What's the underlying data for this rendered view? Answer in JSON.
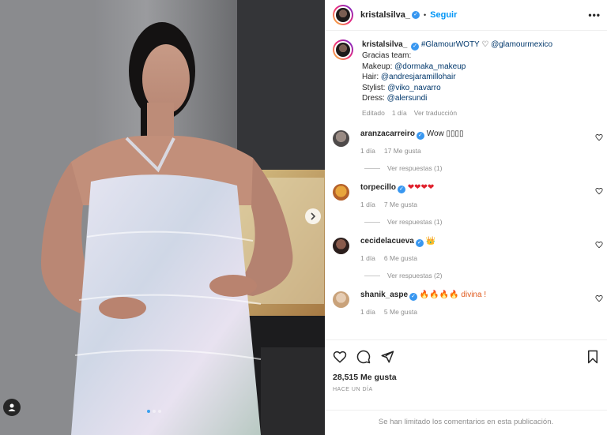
{
  "post": {
    "author": "kristalsilva_",
    "follow_label": "Seguir",
    "separator": "•",
    "more_label": "•••",
    "caption": {
      "author": "kristalsilva_",
      "hashtag": "#GlamourWOTY",
      "heart": "♡",
      "mention": "@glamourmexico",
      "lines": [
        {
          "label": "Gracias team:",
          "link": ""
        },
        {
          "label": "Makeup: ",
          "link": "@dormaka_makeup"
        },
        {
          "label": "Hair: ",
          "link": "@andresjaramillohair"
        },
        {
          "label": "Stylist: ",
          "link": "@viko_navarro"
        },
        {
          "label": "Dress: ",
          "link": "@alersundi"
        }
      ],
      "edited": "Editado",
      "time": "1 día",
      "translate": "Ver traducción"
    }
  },
  "comments": [
    {
      "user": "aranzacarreiro",
      "text": "Wow 𝅘𝅥𝅘𝅥𝅘𝅥𝅘𝅥",
      "display_text": "Wow ▯▯▯▯",
      "time": "1 día",
      "likes": "17 Me gusta",
      "replies": "Ver respuestas (1)"
    },
    {
      "user": "torpecillo",
      "text": "❤❤❤❤",
      "time": "1 día",
      "likes": "7 Me gusta",
      "replies": "Ver respuestas (1)"
    },
    {
      "user": "cecidelacueva",
      "text": "👑",
      "time": "1 día",
      "likes": "6 Me gusta",
      "replies": "Ver respuestas (2)"
    },
    {
      "user": "shanik_aspe",
      "text": "🔥🔥🔥🔥 divina !",
      "time": "1 día",
      "likes": "5 Me gusta",
      "replies": ""
    }
  ],
  "stats": {
    "likes": "28,515 Me gusta",
    "posted_ago": "HACE UN DÍA"
  },
  "footer": {
    "notice": "Se han limitado los comentarios en esta publicación."
  },
  "carousel": {
    "total_slides": 3,
    "current_slide": 1
  },
  "colors": {
    "accent": "#0095f6",
    "verified": "#3897f0",
    "heart_red": "#e0212d",
    "secondary_text": "#8e8e8e"
  }
}
